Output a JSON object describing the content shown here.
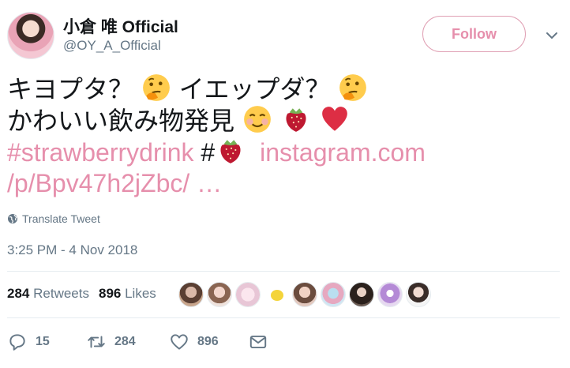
{
  "user": {
    "display_name": "小倉 唯 Official",
    "handle": "@OY_A_Official",
    "follow_label": "Follow"
  },
  "tweet": {
    "line1_a": "キヨプタ？",
    "line1_b": "イエップダ？",
    "line2": "かわいい飲み物発見",
    "hashtag1": "#strawberrydrink",
    "hashtag2": "#",
    "link_part1": "instagram.com",
    "link_part2": "/p/Bpv47h2jZbc/",
    "ellipsis": "…",
    "emojis": [
      "thinking-face",
      "thinking-face",
      "smiling-face",
      "strawberry",
      "red-heart",
      "strawberry"
    ]
  },
  "translate_label": "Translate Tweet",
  "timestamp": "3:25 PM - 4 Nov 2018",
  "stats": {
    "retweets_count": "284",
    "retweets_label": "Retweets",
    "likes_count": "896",
    "likes_label": "Likes"
  },
  "actions": {
    "reply_count": "15",
    "retweet_count": "284",
    "like_count": "896"
  },
  "colors": {
    "accent_pink": "#e68fac",
    "text": "#14171a",
    "muted": "#657786"
  }
}
